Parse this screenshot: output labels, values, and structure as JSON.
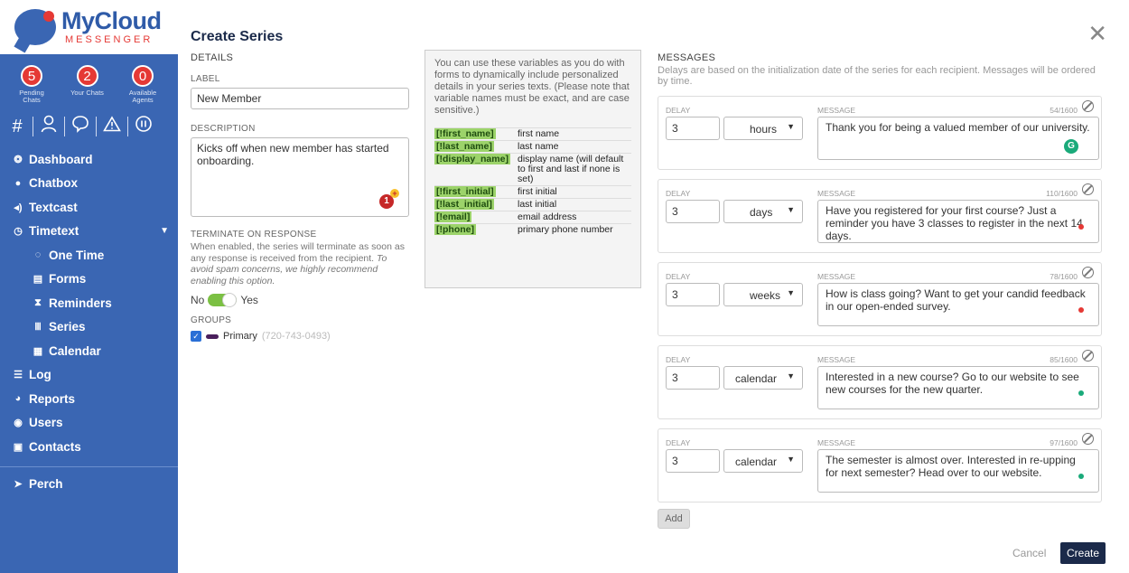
{
  "logo": {
    "main": "MyCloud",
    "sub": "MESSENGER"
  },
  "stats": [
    {
      "value": "5",
      "label": "Pending Chats"
    },
    {
      "value": "2",
      "label": "Your Chats"
    },
    {
      "value": "0",
      "label": "Available Agents"
    }
  ],
  "nav": {
    "dashboard": "Dashboard",
    "chatbox": "Chatbox",
    "textcast": "Textcast",
    "timetext": "Timetext",
    "one_time": "One Time",
    "forms": "Forms",
    "reminders": "Reminders",
    "series": "Series",
    "calendar": "Calendar",
    "log": "Log",
    "reports": "Reports",
    "users": "Users",
    "contacts": "Contacts",
    "perch": "Perch"
  },
  "form": {
    "title": "Create Series",
    "details_heading": "DETAILS",
    "label_heading": "LABEL",
    "label_value": "New Member",
    "description_heading": "DESCRIPTION",
    "description_value": "Kicks off when new member has started onboarding.",
    "description_badge": "1",
    "terminate_heading": "TERMINATE ON RESPONSE",
    "terminate_text": "When enabled, the series will terminate as soon as any response is received from the recipient.",
    "terminate_italic": "To avoid spam concerns, we highly recommend enabling this option.",
    "toggle_no": "No",
    "toggle_yes": "Yes",
    "groups_heading": "GROUPS",
    "group_name": "Primary",
    "group_phone": "(720-743-0493)"
  },
  "variables": {
    "intro": "You can use these variables as you do with forms to dynamically include personalized details in your series texts. (Please note that variable names must be exact, and are case sensitive.)",
    "rows": [
      {
        "tag": "[!first_name]",
        "desc": "first name"
      },
      {
        "tag": "[!last_name]",
        "desc": "last name"
      },
      {
        "tag": "[!display_name]",
        "desc": "display name (will default to first and last if none is set)"
      },
      {
        "tag": "[!first_initial]",
        "desc": "first initial"
      },
      {
        "tag": "[!last_initial]",
        "desc": "last initial"
      },
      {
        "tag": "[!email]",
        "desc": "email address"
      },
      {
        "tag": "[!phone]",
        "desc": "primary phone number"
      }
    ]
  },
  "messages": {
    "heading": "MESSAGES",
    "note": "Delays are based on the initialization date of the series for each recipient. Messages will be ordered by time.",
    "delay_label": "DELAY",
    "message_label": "MESSAGE",
    "items": [
      {
        "delay": "3",
        "unit": "hours",
        "count": "54/1600",
        "text": "Thank you for being a valued member of our university.",
        "dot": ""
      },
      {
        "delay": "3",
        "unit": "days",
        "count": "110/1600",
        "text": "Have you registered for your first course? Just a reminder you have 3 classes to register in the next 14 days.",
        "dot": "#e53935"
      },
      {
        "delay": "3",
        "unit": "weeks",
        "count": "78/1600",
        "text": "How is class going? Want to get your candid feedback in our open-ended survey.",
        "dot": "#e53935"
      },
      {
        "delay": "3",
        "unit": "calendar",
        "count": "85/1600",
        "text": "Interested in a new course? Go to our website to see new courses for the new quarter.",
        "dot": "#1aaa7a"
      },
      {
        "delay": "3",
        "unit": "calendar",
        "count": "97/1600",
        "text": "The semester is almost over. Interested in re-upping for next semester? Head over to our website.",
        "dot": "#1aaa7a"
      }
    ]
  },
  "buttons": {
    "add": "Add",
    "cancel": "Cancel",
    "create": "Create"
  },
  "colors": {
    "sidebar": "#3a66b3",
    "accent_red": "#e53935",
    "create_button": "#1b2a4a",
    "variable_tag": "#9cd36a"
  }
}
